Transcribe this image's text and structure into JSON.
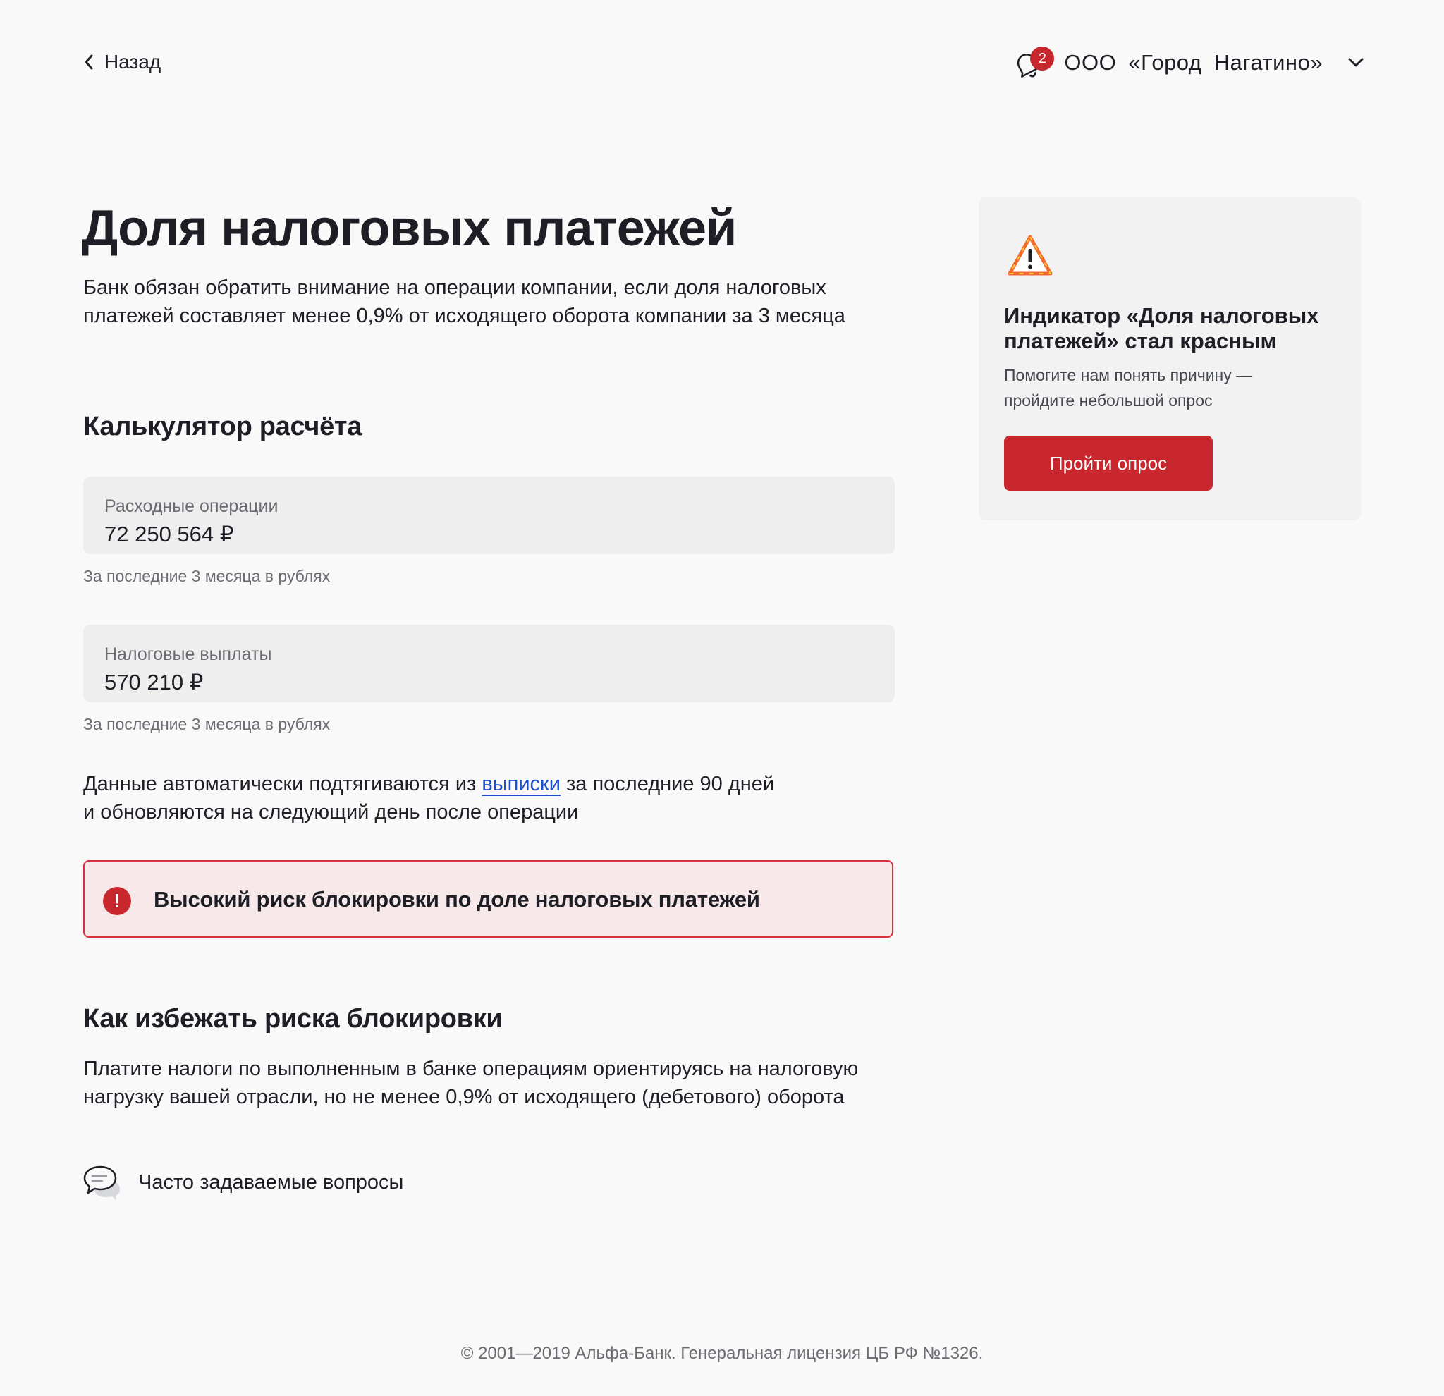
{
  "header": {
    "back_label": "Назад",
    "notifications_count": "2",
    "company_name": "ООО «Город Нагатино»"
  },
  "main": {
    "title": "Доля налоговых платежей",
    "lead": "Банк обязан обратить внимание на операции компании, если доля налоговых платежей составляет менее 0,9% от исходящего оборота компании за 3 месяца",
    "calculator_heading": "Калькулятор расчёта",
    "fields": [
      {
        "label": "Расходные операции",
        "value": "72 250 564 ₽",
        "hint": "За последние 3 месяца в рублях"
      },
      {
        "label": "Налоговые выплаты",
        "value": "570 210 ₽",
        "hint": "За последние 3 месяца в рублях"
      }
    ],
    "info_before_link": "Данные автоматически подтягиваются из ",
    "info_link": "выписки",
    "info_after_link": " за последние 90 дней",
    "info_line2": "и обновляются на следующий день после операции",
    "alert_text": "Высокий риск блокировки по доле налоговых платежей",
    "avoid_heading": "Как избежать риска блокировки",
    "advice": "Платите налоги по выполненным в банке операциям ориентируясь на налоговую нагрузку вашей отрасли, но не менее 0,9% от исходящего (дебетового) оборота",
    "faq_label": "Часто задаваемые вопросы"
  },
  "side_card": {
    "title": "Индикатор «Доля налоговых платежей» стал красным",
    "text": "Помогите нам понять причину — пройдите небольшой опрос",
    "button_label": "Пройти опрос"
  },
  "footer": {
    "text": "© 2001—2019 Альфа-Банк. Генеральная лицензия ЦБ РФ №1326."
  },
  "colors": {
    "brand_red": "#c8282d",
    "link_blue": "#1d4ed0",
    "alert_bg": "#f7e8e9",
    "field_bg": "#eeeeee"
  },
  "icons": [
    "chevron-left-icon",
    "bell-icon",
    "chevron-down-icon",
    "warning-triangle-icon",
    "exclamation-icon",
    "chat-bubbles-icon"
  ]
}
